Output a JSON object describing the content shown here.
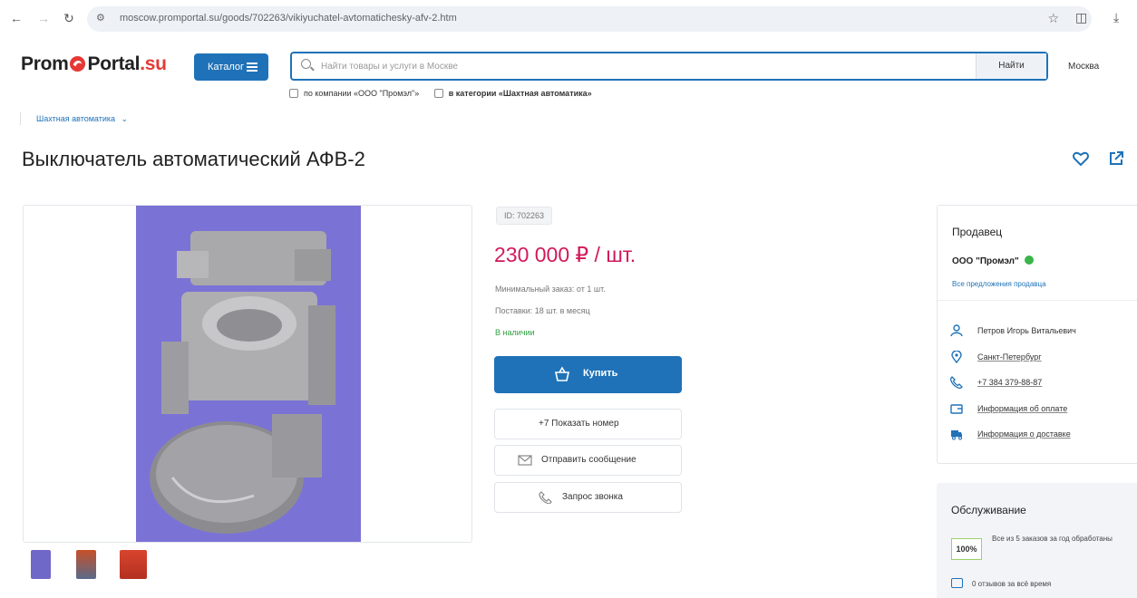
{
  "browser": {
    "url": "moscow.promportal.su/goods/702263/vikiyuchatel-avtomatichesky-afv-2.htm"
  },
  "header": {
    "logo_prefix": "Prom",
    "logo_mid": "Portal",
    "logo_suffix": ".su",
    "catalog_label": "Каталог",
    "search_placeholder": "Найти товары и услуги в Москве",
    "search_button": "Найти",
    "city": "Москва",
    "filter_company": "по компании «ООО \"Промэл\"»",
    "filter_category": "в категории «Шахтная автоматика»",
    "breadcrumb": "Шахтная автоматика"
  },
  "product": {
    "title": "Выключатель автоматический АФВ-2",
    "id_label": "ID: 702263",
    "price": "230 000 ₽ / шт.",
    "min_order": "Минимальный заказ: от 1 шт.",
    "supply": "Поставки: 18 шт. в месяц",
    "stock": "В наличии",
    "buy_label": "Купить",
    "phone_label": "+7 Показать номер",
    "message_label": "Отправить сообщение",
    "callback_label": "Запрос звонка"
  },
  "seller": {
    "heading": "Продавец",
    "name": "ООО \"Промэл\"",
    "all_offers": "Все предложения продавца",
    "contact": "Петров Игорь Витальевич",
    "city": "Санкт-Петербург",
    "phone": "+7 384 379-88-87",
    "payment": "Информация об оплате",
    "delivery": "Информация о доставке"
  },
  "service": {
    "heading": "Обслуживание",
    "percent": "100%",
    "percent_text": "Все из 5 заказов за год обработаны",
    "reviews": "0 отзывов за всё время"
  },
  "colors": {
    "brand_blue": "#1f72b8",
    "price_red": "#d1195a",
    "stock_green": "#2e9e3e",
    "logo_red": "#e53935"
  }
}
